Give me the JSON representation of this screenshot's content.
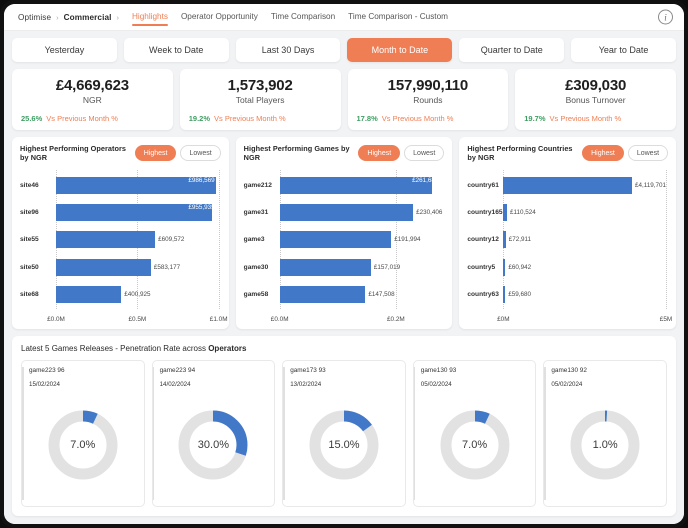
{
  "topbar": {
    "breadcrumb": [
      {
        "label": "Optimise",
        "bold": false
      },
      {
        "label": "Commercial",
        "bold": true
      }
    ],
    "tabs": [
      {
        "label": "Highlights",
        "active": true
      },
      {
        "label": "Operator Opportunity",
        "active": false
      },
      {
        "label": "Time Comparison",
        "active": false
      },
      {
        "label": "Time Comparison - Custom",
        "active": false
      }
    ],
    "info_icon": "info-icon"
  },
  "date_range": {
    "options": [
      {
        "label": "Yesterday",
        "active": false
      },
      {
        "label": "Week to Date",
        "active": false
      },
      {
        "label": "Last 30 Days",
        "active": false
      },
      {
        "label": "Month to Date",
        "active": true
      },
      {
        "label": "Quarter to Date",
        "active": false
      },
      {
        "label": "Year to Date",
        "active": false
      }
    ]
  },
  "kpis": [
    {
      "value": "£4,669,623",
      "label": "NGR",
      "delta": "25.6%",
      "comparison": "Vs Previous Month %"
    },
    {
      "value": "1,573,902",
      "label": "Total Players",
      "delta": "19.2%",
      "comparison": "Vs Previous Month %"
    },
    {
      "value": "157,990,110",
      "label": "Rounds",
      "delta": "17.8%",
      "comparison": "Vs Previous Month %"
    },
    {
      "value": "£309,030",
      "label": "Bonus Turnover",
      "delta": "19.7%",
      "comparison": "Vs Previous Month %"
    }
  ],
  "colors": {
    "accent_orange": "#ef7e54",
    "bar_blue": "#4179c8",
    "positive_green": "#3f9e63",
    "track_grey": "#e2e2e2",
    "page_bg": "#f2f3f5"
  },
  "chart_data": [
    {
      "type": "bar",
      "orientation": "horizontal",
      "title": "Highest Performing Operators by NGR",
      "toggle": [
        {
          "label": "Highest",
          "active": true
        },
        {
          "label": "Lowest",
          "active": false
        }
      ],
      "categories": [
        "site46",
        "site96",
        "site55",
        "site50",
        "site68"
      ],
      "values": [
        986569,
        955935,
        609572,
        583177,
        400925
      ],
      "value_labels": [
        "£986,569",
        "£955,935",
        "£609,572",
        "£583,177",
        "£400,925"
      ],
      "xlabel": "",
      "ylabel": "",
      "xlim": [
        0,
        1000000
      ],
      "ticks": [
        {
          "label": "£0.0M",
          "value": 0
        },
        {
          "label": "£0.5M",
          "value": 500000
        },
        {
          "label": "£1.0M",
          "value": 1000000
        }
      ],
      "grid": true,
      "legend": "none"
    },
    {
      "type": "bar",
      "orientation": "horizontal",
      "title": "Highest Performing Games by NGR",
      "toggle": [
        {
          "label": "Highest",
          "active": true
        },
        {
          "label": "Lowest",
          "active": false
        }
      ],
      "categories": [
        "game212",
        "game31",
        "game3",
        "game30",
        "game58"
      ],
      "values": [
        261684,
        230406,
        191994,
        157019,
        147508
      ],
      "value_labels": [
        "£261,684",
        "£230,406",
        "£191,994",
        "£157,019",
        "£147,508"
      ],
      "xlabel": "",
      "ylabel": "",
      "xlim": [
        0,
        280000
      ],
      "ticks": [
        {
          "label": "£0.0M",
          "value": 0
        },
        {
          "label": "£0.2M",
          "value": 200000
        }
      ],
      "grid": true,
      "legend": "none"
    },
    {
      "type": "bar",
      "orientation": "horizontal",
      "title": "Highest Performing Countries by NGR",
      "toggle": [
        {
          "label": "Highest",
          "active": true
        },
        {
          "label": "Lowest",
          "active": false
        }
      ],
      "categories": [
        "country61",
        "country165",
        "country12",
        "country5",
        "country63"
      ],
      "values": [
        4119701,
        110524,
        72911,
        60942,
        59680
      ],
      "value_labels": [
        "£4,119,701",
        "£110,524",
        "£72,911",
        "£60,942",
        "£59,680"
      ],
      "xlabel": "",
      "ylabel": "",
      "xlim": [
        0,
        5000000
      ],
      "ticks": [
        {
          "label": "£0M",
          "value": 0
        },
        {
          "label": "£5M",
          "value": 5000000
        }
      ],
      "grid": true,
      "legend": "none"
    },
    {
      "type": "pie",
      "variant": "donut-group",
      "title": "Latest 5 Games Releases - Penetration Rate across Operators",
      "title_prefix": "Latest 5 Games Releases - Penetration Rate across ",
      "title_suffix": "Operators",
      "items": [
        {
          "name": "game223 96",
          "date": "15/02/2024",
          "percent": 7.0,
          "percent_label": "7.0%"
        },
        {
          "name": "game223 94",
          "date": "14/02/2024",
          "percent": 30.0,
          "percent_label": "30.0%"
        },
        {
          "name": "game173 93",
          "date": "13/02/2024",
          "percent": 15.0,
          "percent_label": "15.0%"
        },
        {
          "name": "game130 93",
          "date": "05/02/2024",
          "percent": 7.0,
          "percent_label": "7.0%"
        },
        {
          "name": "game130 92",
          "date": "05/02/2024",
          "percent": 1.0,
          "percent_label": "1.0%"
        }
      ]
    }
  ]
}
